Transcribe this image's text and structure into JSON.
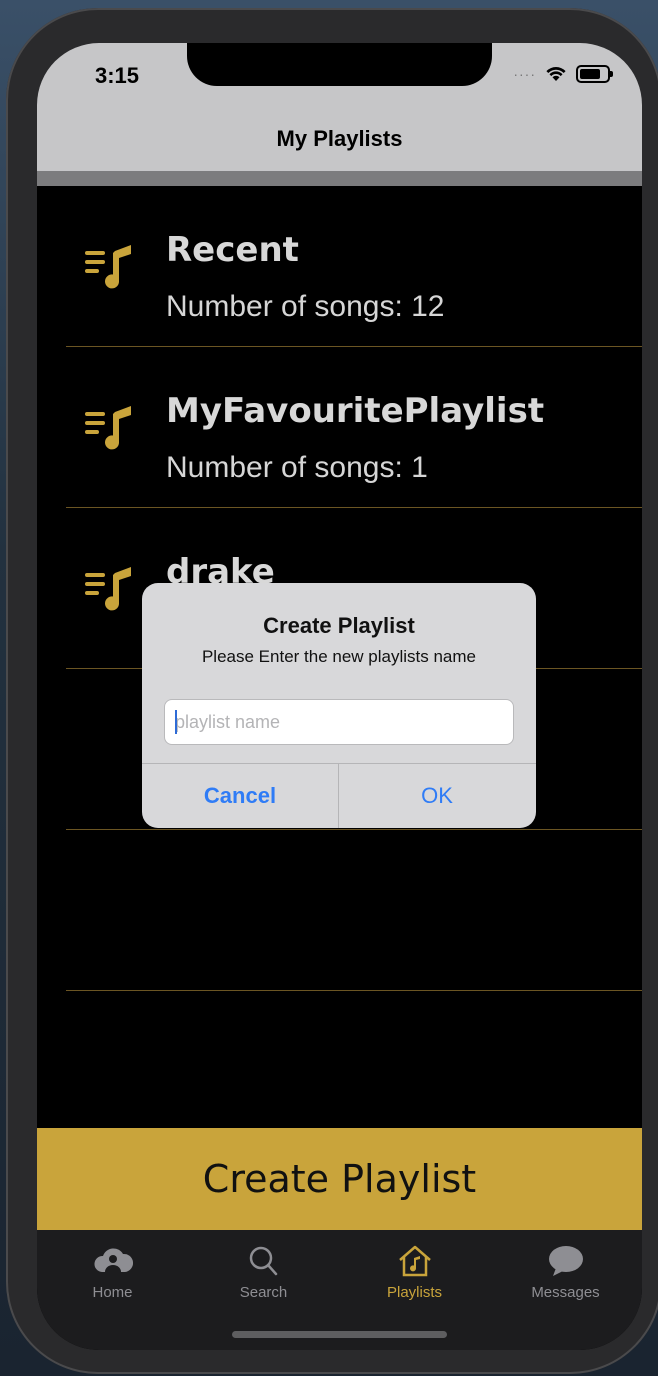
{
  "status_bar": {
    "time": "3:15"
  },
  "nav": {
    "title": "My Playlists"
  },
  "playlists": [
    {
      "name": "Recent",
      "subtitle": "Number of songs: 12"
    },
    {
      "name": "MyFavouritePlaylist",
      "subtitle": "Number of songs: 1"
    },
    {
      "name": "drake",
      "subtitle": ""
    }
  ],
  "create_button": {
    "label": "Create Playlist"
  },
  "tabs": [
    {
      "label": "Home",
      "icon": "cloud-person-icon"
    },
    {
      "label": "Search",
      "icon": "magnifier-icon"
    },
    {
      "label": "Playlists",
      "icon": "music-house-icon",
      "active": true
    },
    {
      "label": "Messages",
      "icon": "chat-bubble-icon"
    }
  ],
  "alert": {
    "title": "Create Playlist",
    "message": "Please Enter the new playlists name",
    "input": {
      "placeholder": "playlist name",
      "value": ""
    },
    "cancel_label": "Cancel",
    "ok_label": "OK"
  },
  "colors": {
    "accent": "#c9a43b",
    "header_bg": "#c6c6c8",
    "list_bg": "#000000",
    "link_blue": "#2f7cf6"
  }
}
